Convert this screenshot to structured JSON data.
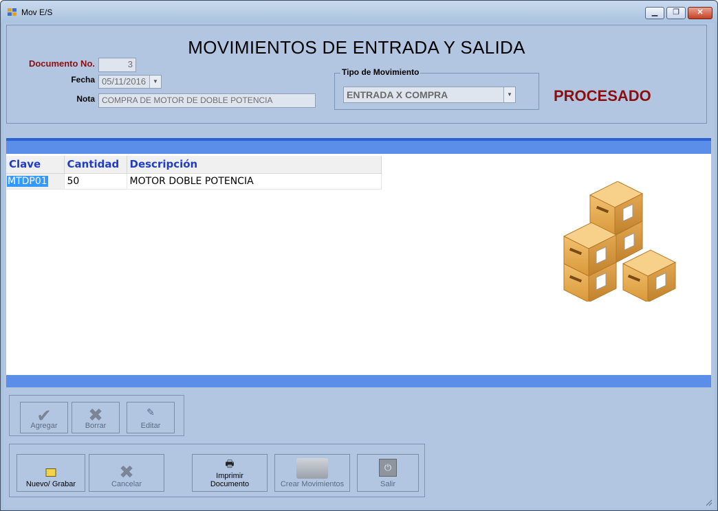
{
  "window": {
    "title": "Mov E/S"
  },
  "header": {
    "title": "MOVIMIENTOS DE ENTRADA Y SALIDA",
    "documento_label": "Documento No.",
    "documento_value": "3",
    "fecha_label": "Fecha",
    "fecha_value": "05/11/2016",
    "nota_label": "Nota",
    "nota_value": "COMPRA DE MOTOR DE DOBLE POTENCIA",
    "tipo_legend": "Tipo de Movimiento",
    "tipo_value": "ENTRADA X COMPRA",
    "status": "PROCESADO"
  },
  "grid": {
    "columns": [
      "Clave",
      "Cantidad",
      "Descripción"
    ],
    "rows": [
      {
        "clave": "MTDP01",
        "cantidad": "50",
        "descripcion": "MOTOR DOBLE POTENCIA"
      }
    ]
  },
  "item_buttons": {
    "agregar": "Agregar",
    "borrar": "Borrar",
    "editar": "Editar"
  },
  "doc_buttons": {
    "nuevo": "Nuevo/ Grabar",
    "cancelar": "Cancelar",
    "imprimir": "Imprimir\nDocumento",
    "crear": "Crear Movimientos",
    "salir": "Salir"
  },
  "colors": {
    "accent_blue": "#5b8ee8",
    "header_text_blue": "#1f3dc7",
    "status_red": "#8b0f0f",
    "window_bg": "#b2c6e2"
  },
  "icons": {
    "app": "app-window-icon",
    "agregar": "checkmark-icon",
    "borrar": "x-icon",
    "editar": "edit-icon",
    "nuevo": "save-icon",
    "cancelar": "x-icon",
    "imprimir": "printer-icon",
    "crear": "cash-register-icon",
    "salir": "power-icon",
    "boxes": "stacked-boxes-illustration"
  }
}
